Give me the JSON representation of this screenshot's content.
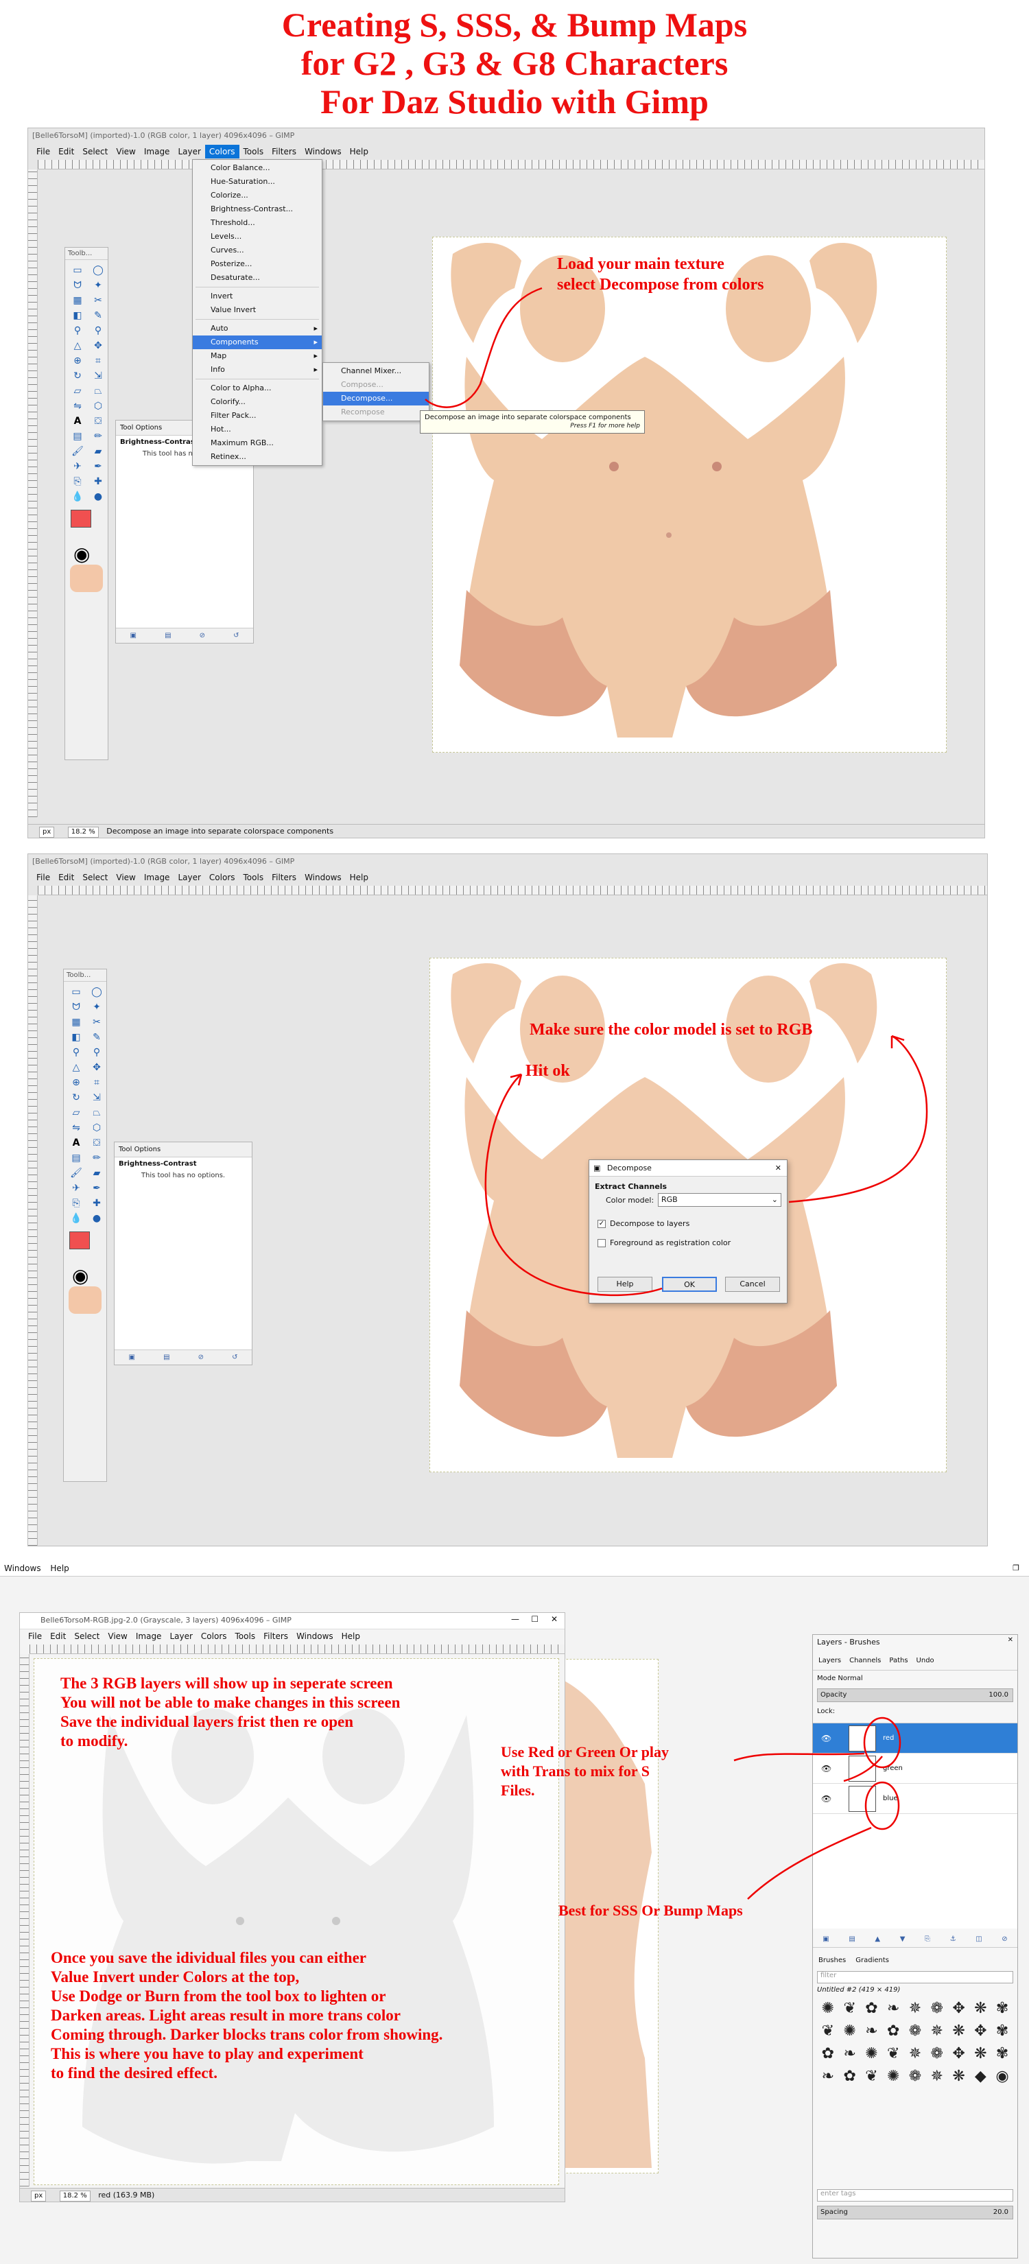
{
  "title": {
    "line1": "Creating S, SSS, & Bump Maps",
    "line2": "for G2 , G3 & G8 Characters",
    "line3": "For Daz Studio with Gimp"
  },
  "screen1": {
    "window_title": "[Belle6TorsoM] (imported)-1.0 (RGB color, 1 layer) 4096x4096 – GIMP",
    "menubar": [
      "File",
      "Edit",
      "Select",
      "View",
      "Image",
      "Layer",
      "Colors",
      "Tools",
      "Filters",
      "Windows",
      "Help"
    ],
    "active_menu": "Colors",
    "colors_menu": [
      {
        "label": "Color Balance..."
      },
      {
        "label": "Hue-Saturation..."
      },
      {
        "label": "Colorize..."
      },
      {
        "label": "Brightness-Contrast..."
      },
      {
        "label": "Threshold..."
      },
      {
        "label": "Levels..."
      },
      {
        "label": "Curves..."
      },
      {
        "label": "Posterize..."
      },
      {
        "label": "Desaturate..."
      },
      {
        "label": "Invert"
      },
      {
        "label": "Value Invert"
      },
      {
        "label": "Auto",
        "submenu": true
      },
      {
        "label": "Components",
        "submenu": true,
        "highlighted": true
      },
      {
        "label": "Map",
        "submenu": true
      },
      {
        "label": "Info",
        "submenu": true
      },
      {
        "label": "Color to Alpha..."
      },
      {
        "label": "Colorify..."
      },
      {
        "label": "Filter Pack..."
      },
      {
        "label": "Hot..."
      },
      {
        "label": "Maximum RGB..."
      },
      {
        "label": "Retinex..."
      }
    ],
    "components_menu": [
      {
        "label": "Channel Mixer..."
      },
      {
        "label": "Compose...",
        "disabled": true
      },
      {
        "label": "Decompose...",
        "highlighted": true
      },
      {
        "label": "Recompose",
        "disabled": true
      }
    ],
    "tooltip": {
      "text": "Decompose an image into separate colorspace components",
      "hint": "Press F1 for more help"
    },
    "annotation": [
      "Load your main texture",
      "select Decompose from colors"
    ],
    "toolbox_title": "Toolb...",
    "tool_options": {
      "title": "Tool Options",
      "tool": "Brightness-Contrast",
      "message": "This tool has no options."
    },
    "status": {
      "unit": "px",
      "zoom": "18.2 %",
      "message": "Decompose an image into separate colorspace components"
    }
  },
  "screen2": {
    "window_title": "[Belle6TorsoM] (imported)-1.0 (RGB color, 1 layer) 4096x4096 – GIMP",
    "menubar": [
      "File",
      "Edit",
      "Select",
      "View",
      "Image",
      "Layer",
      "Colors",
      "Tools",
      "Filters",
      "Windows",
      "Help"
    ],
    "toolbox_title": "Toolb...",
    "tool_options": {
      "title": "Tool Options",
      "tool": "Brightness-Contrast",
      "message": "This tool has no options."
    },
    "dialog": {
      "title": "Decompose",
      "section": "Extract Channels",
      "color_model_label": "Color model:",
      "color_model_value": "RGB",
      "decompose_layers": "Decompose to layers",
      "foreground_reg": "Foreground as registration color",
      "help": "Help",
      "ok": "OK",
      "cancel": "Cancel"
    },
    "annotation_rgb": "Make sure the color model is set to RGB",
    "annotation_ok": "Hit ok"
  },
  "screen3": {
    "top_menu": [
      "Windows",
      "Help"
    ],
    "window_title": "Belle6TorsoM-RGB.jpg-2.0 (Grayscale, 3 layers) 4096x4096 – GIMP",
    "menubar": [
      "File",
      "Edit",
      "Select",
      "View",
      "Image",
      "Layer",
      "Colors",
      "Tools",
      "Filters",
      "Windows",
      "Help"
    ],
    "status": {
      "unit": "px",
      "zoom": "18.2 %",
      "message": "red (163.9 MB)"
    },
    "annotation_top": [
      "The 3 RGB layers will show up in seperate screen",
      "You will not be able to make changes in this screen",
      "Save the individual layers frist then re open",
      "to modify."
    ],
    "annotation_bottom": [
      "Once you save the idividual files you can either",
      "Value Invert under Colors at the top,",
      "Use Dodge or Burn from the tool box to lighten or",
      "Darken areas. Light areas result in more trans color",
      "Coming through. Darker blocks trans color from showing.",
      "This is where you have to play and experiment",
      "to find the desired effect."
    ],
    "annotation_s": [
      "Use Red or Green Or play",
      "with Trans to mix for S",
      "Files."
    ],
    "annotation_sss": "Best for SSS Or Bump Maps",
    "layers_panel": {
      "title": "Layers - Brushes",
      "tabs": [
        "Layers",
        "Channels",
        "Paths",
        "Undo"
      ],
      "mode_label": "Mode Normal",
      "opacity_label": "Opacity",
      "opacity_value": "100.0",
      "lock_label": "Lock:",
      "layers": [
        {
          "name": "red",
          "selected": true
        },
        {
          "name": "green",
          "selected": false
        },
        {
          "name": "blue",
          "selected": false
        }
      ],
      "brush_tabs": [
        "Brushes",
        "Gradients"
      ],
      "filter_placeholder": "filter",
      "brush_name": "Untitled #2 (419 × 419)",
      "brush_tag_placeholder": "enter tags",
      "spacing_label": "Spacing",
      "spacing_value": "20.0"
    }
  }
}
